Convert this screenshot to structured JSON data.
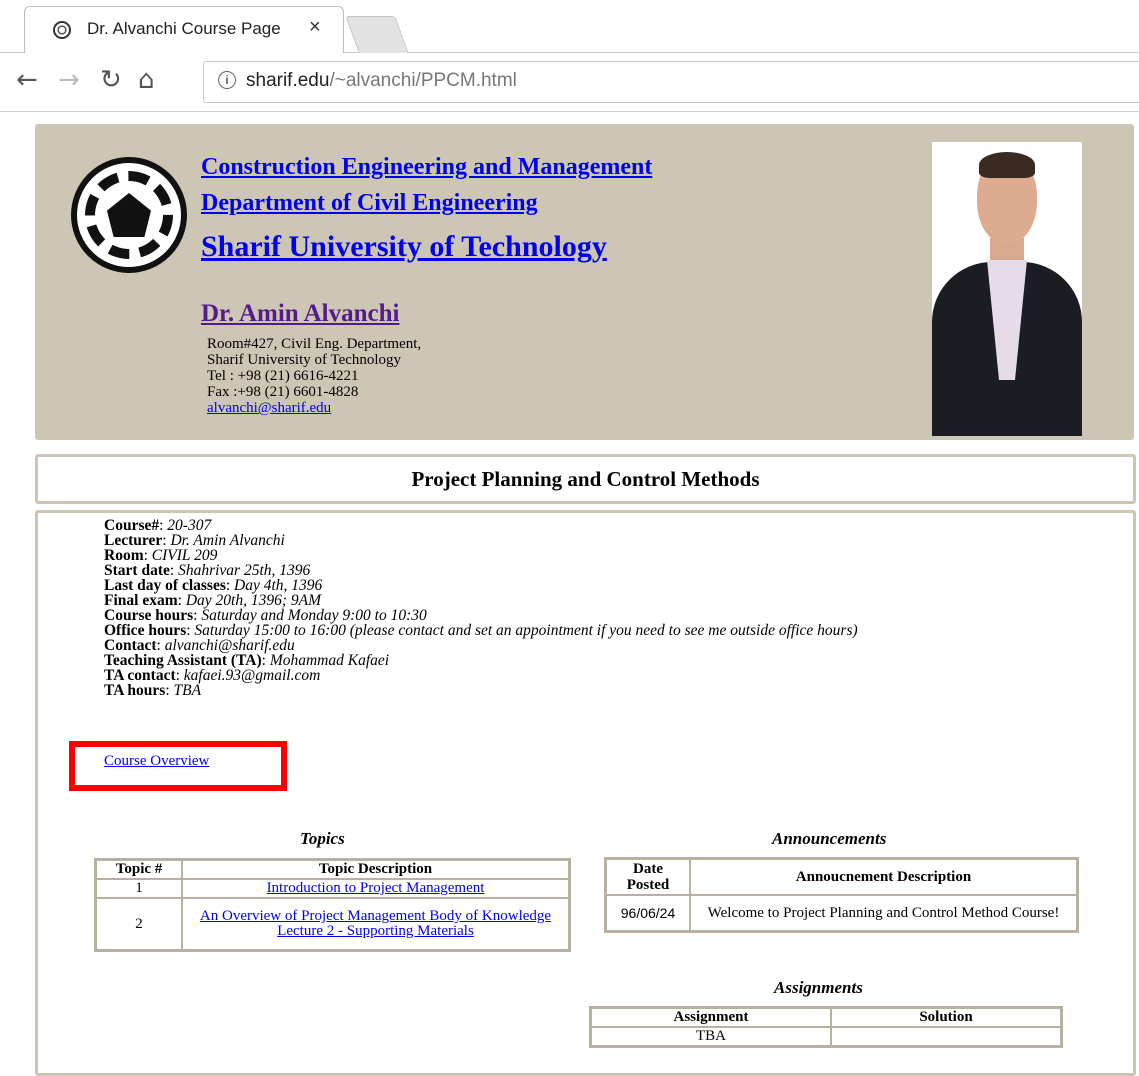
{
  "browser": {
    "tab_title": "Dr. Alvanchi Course Page",
    "tab_close": "×",
    "url_host": "sharif.edu",
    "url_path": "/~alvanchi/PPCM.html",
    "icons": [
      "back-arrow-icon",
      "forward-arrow-icon",
      "reload-icon",
      "home-icon",
      "info-icon"
    ]
  },
  "header": {
    "link1": "Construction Engineering and Management",
    "link2": "Department of Civil Engineering",
    "link3": "Sharif University of Technology",
    "professor": "Dr. Amin Alvanchi",
    "address_line1": "Room#427, Civil Eng. Department,",
    "address_line2": "Sharif University of Technology",
    "tel": "Tel : +98 (21) 6616-4221",
    "fax": "Fax :+98 (21) 6601-4828",
    "email": "alvanchi@sharif.edu",
    "bg_color": "#cdc6b5"
  },
  "course_title": "Project Planning and Control Methods",
  "info": {
    "course_label": "Course#",
    "course_value": "20-307",
    "lecturer_label": "Lecturer",
    "lecturer_value": "Dr. Amin Alvanchi",
    "room_label": "Room",
    "room_value": "CIVIL 209",
    "start_label": "Start date",
    "start_value": "Shahrivar 25th, 1396",
    "last_label": "Last day of classes",
    "last_value": "Day 4th, 1396",
    "final_label": "Final exam",
    "final_value": "Day 20th, 1396; 9AM",
    "hours_label": "Course hours",
    "hours_value": "Saturday and Monday 9:00 to 10:30",
    "office_label": "Office hours",
    "office_value": "Saturday 15:00 to 16:00 (please contact and set an appointment if you need to see me outside office hours)",
    "contact_label": "Contact",
    "contact_value": "alvanchi@sharif.edu",
    "ta_label": "Teaching Assistant (TA)",
    "ta_value": "Mohammad Kafaei",
    "ta_contact_label": "TA contact",
    "ta_contact_value": "kafaei.93@gmail.com",
    "ta_hours_label": "TA hours",
    "ta_hours_value": "TBA"
  },
  "overview_link": "Course Overview",
  "topics": {
    "title": "Topics",
    "col1": "Topic #",
    "col2": "Topic Description",
    "rows": [
      {
        "num": "1",
        "desc": "Introduction to Project Management",
        "extra": ""
      },
      {
        "num": "2",
        "desc": "An Overview of Project Management Body of Knowledge",
        "extra": "Lecture 2 - Supporting Materials"
      }
    ]
  },
  "announcements": {
    "title": "Announcements",
    "col1": "Date Posted",
    "col2": "Annoucnement Description",
    "rows": [
      {
        "date": "96/06/24",
        "desc": "Welcome to Project Planning and Control Method Course!"
      }
    ]
  },
  "assignments": {
    "title": "Assignments",
    "col1": "Assignment",
    "col2": "Solution",
    "rows": [
      {
        "assignment": "TBA",
        "solution": ""
      }
    ]
  },
  "highlight_color": "#ff0000"
}
